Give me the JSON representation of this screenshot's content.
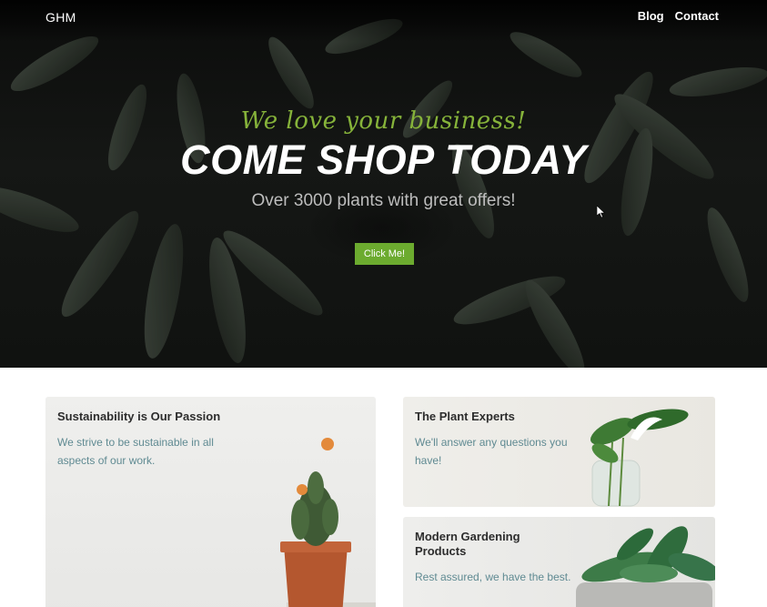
{
  "header": {
    "logo": "GHM",
    "nav": [
      {
        "label": "Blog"
      },
      {
        "label": "Contact"
      }
    ]
  },
  "hero": {
    "tagline": "We love your business!",
    "title": "COME SHOP TODAY",
    "subtitle": "Over 3000 plants with great offers!",
    "button_label": "Click Me!"
  },
  "cards": [
    {
      "title": "Sustainability is Our Passion",
      "text": "We strive to be sustainable in all aspects of our work.",
      "image": "cactus-pot-icon"
    },
    {
      "title": "The Plant Experts",
      "text": "We'll answer any questions you have!",
      "image": "glass-vase-plant-icon"
    },
    {
      "title": "Modern Gardening Products",
      "text": "Rest assured, we have the best.",
      "image": "succulent-pot-icon"
    }
  ],
  "colors": {
    "accent_green": "#6cab2f",
    "script_green": "#86b33a",
    "body_text": "#5f8a92",
    "heading_text": "#2d2d2d"
  }
}
